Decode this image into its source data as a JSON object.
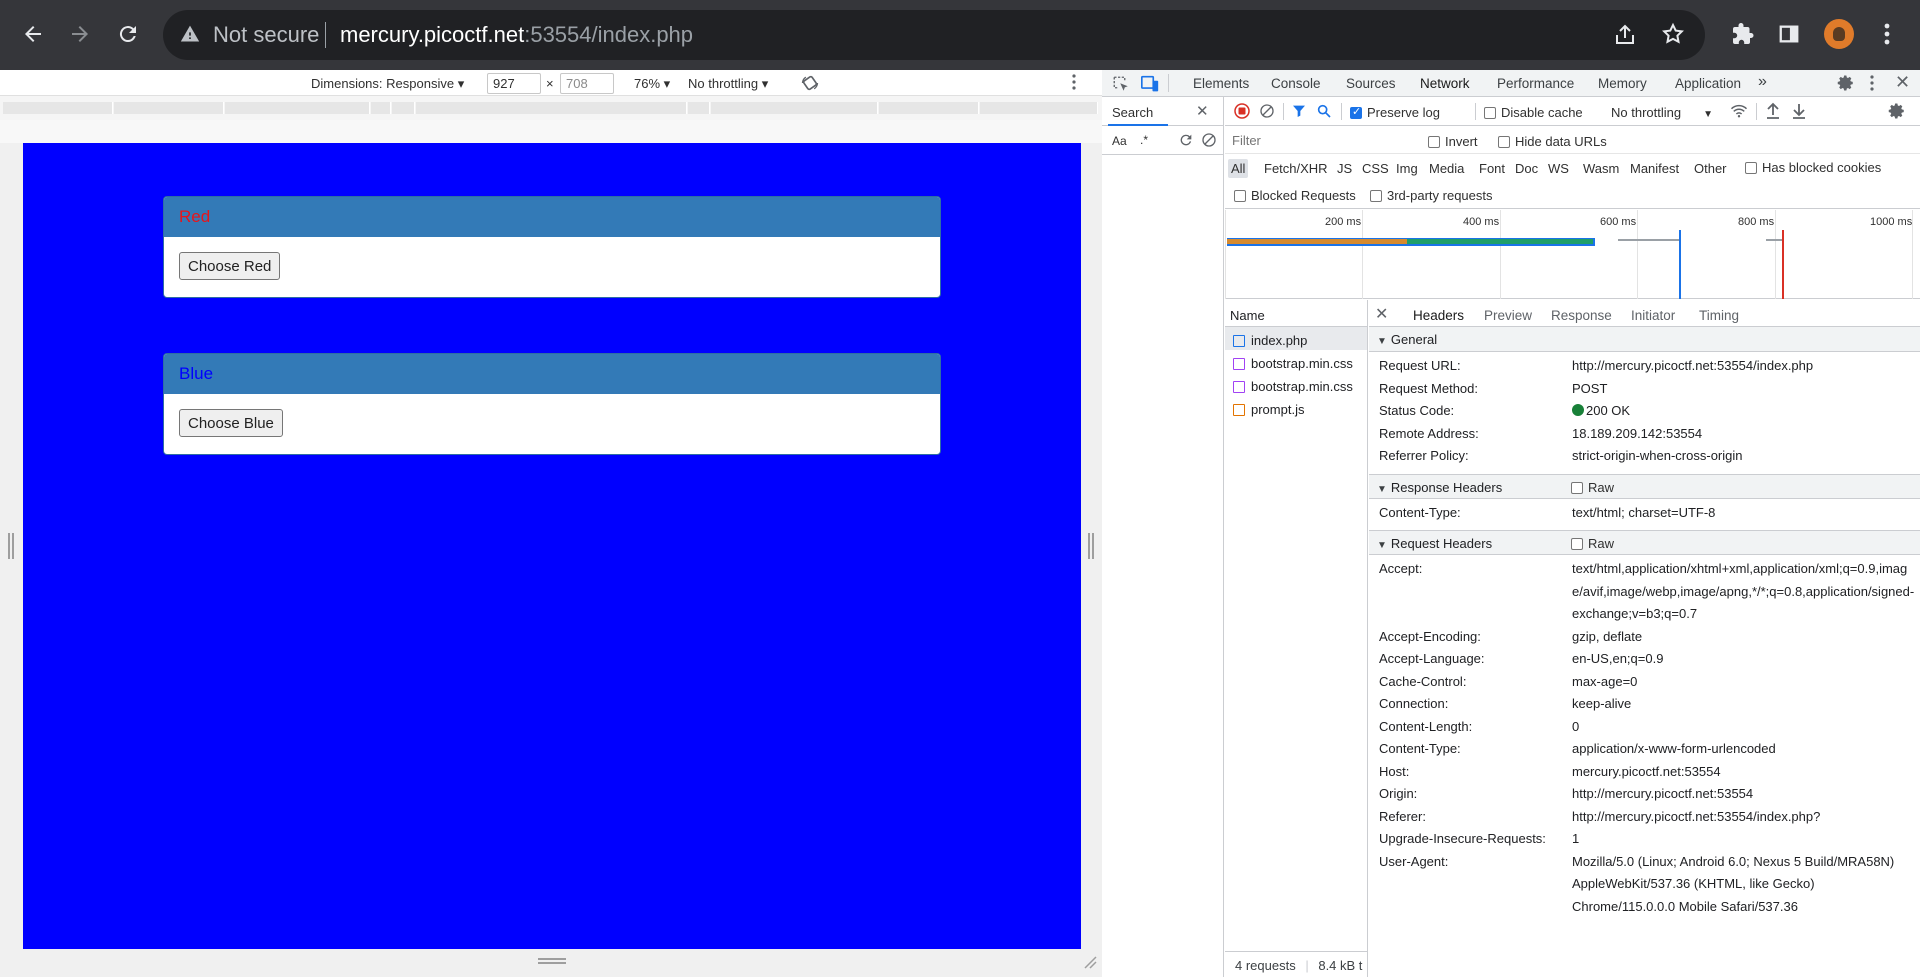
{
  "browser": {
    "security": "Not secure",
    "url_host": "mercury.picoctf.net",
    "url_rest": ":53554/index.php"
  },
  "device_toolbar": {
    "dimensions_label": "Dimensions: Responsive",
    "width": "927",
    "times": "×",
    "height": "708",
    "zoom": "76%",
    "throttling": "No throttling"
  },
  "page": {
    "bg_color": "#0000ff",
    "panels": [
      {
        "title": "Red",
        "title_color": "#e8151a",
        "button": "Choose Red"
      },
      {
        "title": "Blue",
        "title_color": "#0000ff",
        "button": "Choose Blue"
      }
    ]
  },
  "devtools": {
    "tabs": [
      "Elements",
      "Console",
      "Sources",
      "Network",
      "Performance",
      "Memory",
      "Application"
    ],
    "active_tab": "Network",
    "search_tab": "Search",
    "toolbar": {
      "preserve_log": "Preserve log",
      "disable_cache": "Disable cache",
      "throttling": "No throttling"
    },
    "filter_placeholder": "Filter",
    "invert": "Invert",
    "hide_data_urls": "Hide data URLs",
    "types": [
      "All",
      "Fetch/XHR",
      "JS",
      "CSS",
      "Img",
      "Media",
      "Font",
      "Doc",
      "WS",
      "Wasm",
      "Manifest",
      "Other"
    ],
    "has_blocked_cookies": "Has blocked cookies",
    "blocked_requests": "Blocked Requests",
    "third_party": "3rd-party requests",
    "timeline_ticks": [
      "200 ms",
      "400 ms",
      "600 ms",
      "800 ms",
      "1000 ms"
    ],
    "name_header": "Name",
    "requests": [
      {
        "name": "index.php",
        "icon_color": "#1a73e8"
      },
      {
        "name": "bootstrap.min.css",
        "icon_color": "#a142f4"
      },
      {
        "name": "bootstrap.min.css",
        "icon_color": "#a142f4"
      },
      {
        "name": "prompt.js",
        "icon_color": "#e37400"
      }
    ],
    "footer_requests": "4 requests",
    "footer_size": "8.4 kB t",
    "detail_tabs": [
      "Headers",
      "Preview",
      "Response",
      "Initiator",
      "Timing"
    ],
    "general": {
      "title": "General",
      "rows": [
        {
          "k": "Request URL:",
          "v": "http://mercury.picoctf.net:53554/index.php"
        },
        {
          "k": "Request Method:",
          "v": "POST"
        },
        {
          "k": "Status Code:",
          "v": "200 OK"
        },
        {
          "k": "Remote Address:",
          "v": "18.189.209.142:53554"
        },
        {
          "k": "Referrer Policy:",
          "v": "strict-origin-when-cross-origin"
        }
      ]
    },
    "response_headers": {
      "title": "Response Headers",
      "raw": "Raw",
      "rows": [
        {
          "k": "Content-Type:",
          "v": "text/html; charset=UTF-8"
        }
      ]
    },
    "request_headers": {
      "title": "Request Headers",
      "raw": "Raw",
      "rows": [
        {
          "k": "Accept:",
          "v": "text/html,application/xhtml+xml,application/xml;q=0.9,image/avif,image/webp,image/apng,*/*;q=0.8,application/signed-exchange;v=b3;q=0.7"
        },
        {
          "k": "Accept-Encoding:",
          "v": "gzip, deflate"
        },
        {
          "k": "Accept-Language:",
          "v": "en-US,en;q=0.9"
        },
        {
          "k": "Cache-Control:",
          "v": "max-age=0"
        },
        {
          "k": "Connection:",
          "v": "keep-alive"
        },
        {
          "k": "Content-Length:",
          "v": "0"
        },
        {
          "k": "Content-Type:",
          "v": "application/x-www-form-urlencoded"
        },
        {
          "k": "Host:",
          "v": "mercury.picoctf.net:53554"
        },
        {
          "k": "Origin:",
          "v": "http://mercury.picoctf.net:53554"
        },
        {
          "k": "Referer:",
          "v": "http://mercury.picoctf.net:53554/index.php?"
        },
        {
          "k": "Upgrade-Insecure-Requests:",
          "v": "1"
        },
        {
          "k": "User-Agent:",
          "v": "Mozilla/5.0 (Linux; Android 6.0; Nexus 5 Build/MRA58N) AppleWebKit/537.36 (KHTML, like Gecko) Chrome/115.0.0.0 Mobile Safari/537.36"
        }
      ]
    }
  }
}
